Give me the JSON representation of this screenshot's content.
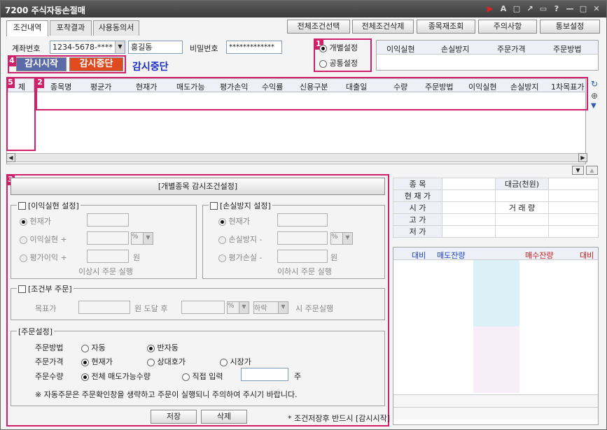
{
  "window": {
    "code": "7200",
    "title": "주식자동손절매"
  },
  "tabs": [
    "조건내역",
    "포착결과",
    "사용동의서"
  ],
  "toolbar": {
    "select_all": "전체조건선택",
    "delete_all": "전체조건삭제",
    "requery": "종목재조회",
    "notice": "주의사항",
    "notify": "통보설정"
  },
  "account": {
    "label": "계좌번호",
    "value": "1234-5678-****",
    "name": "홍길동",
    "pw_label": "비밀번호",
    "pw_value": "*************"
  },
  "mode": {
    "individual": "개별설정",
    "common": "공통설정"
  },
  "summary_headers": [
    "이익실현",
    "손실방지",
    "주문가격",
    "주문방법"
  ],
  "monitor": {
    "start": "감시시작",
    "stop": "감시중단",
    "status": "감시중단"
  },
  "badges": {
    "b1": "1",
    "b2": "2",
    "b3": "3",
    "b4": "4",
    "b5": "5"
  },
  "del_col": "제",
  "grid_headers": [
    "종목명",
    "평균가",
    "현재가",
    "매도가능",
    "평가손익",
    "수익률",
    "신용구분",
    "대출일",
    "수량",
    "주문방법",
    "이익실현",
    "손실방지",
    "1차목표가"
  ],
  "cond": {
    "header_btn": "[개별종목 감시조건설정]",
    "profit": {
      "title": "[이익실현 설정]",
      "current": "현재가",
      "realize": "이익실현",
      "plus": "+",
      "pct": "%",
      "eval": "평가이익",
      "won": "원",
      "note": "이상시 주문 실행"
    },
    "loss": {
      "title": "[손실방지 설정]",
      "current": "현재가",
      "prevent": "손실방지",
      "minus": "-",
      "pct": "%",
      "eval": "평가손실",
      "won": "원",
      "note": "이하시 주문 실행"
    },
    "conditional": {
      "title": "[조건부 주문]",
      "target": "목표가",
      "reach": "원 도달 후",
      "pct": "%",
      "dir": "하락",
      "exec": "시 주문실행"
    },
    "order": {
      "title": "[주문설정]",
      "method_label": "주문방법",
      "auto": "자동",
      "semi": "반자동",
      "price_label": "주문가격",
      "current": "현재가",
      "counter": "상대호가",
      "market": "시장가",
      "qty_label": "주문수량",
      "all": "전체 매도가능수량",
      "direct": "직접 입력",
      "unit": "주",
      "warn": "※ 자동주문은 주문확인창을 생략하고 주문이 실행되니 주의하여 주시기 바랍니다."
    },
    "save": "저장",
    "delete": "삭제",
    "footer": "* 조건저장후 반드시 [감시시작] 버튼을 클릭해야 조건포착이 가능합니다."
  },
  "quote": {
    "item": "종 목",
    "amount": "대금(천원)",
    "current": "현 재 가",
    "open": "시 가",
    "volume": "거 래 량",
    "high": "고 가",
    "low": "저 가",
    "ask_change": "대비",
    "ask_qty": "매도잔량",
    "bid_qty": "매수잔량",
    "bid_change": "대비"
  }
}
